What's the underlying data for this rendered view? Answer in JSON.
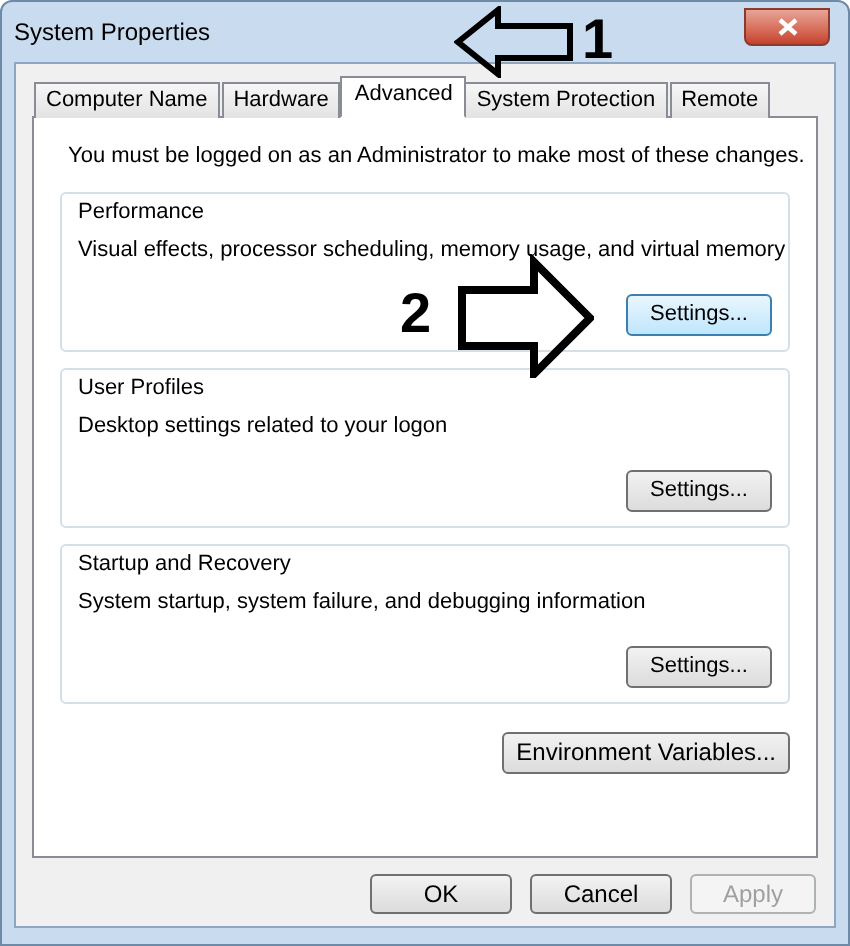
{
  "window": {
    "title": "System Properties"
  },
  "tabs": [
    {
      "label": "Computer Name",
      "selected": false
    },
    {
      "label": "Hardware",
      "selected": false
    },
    {
      "label": "Advanced",
      "selected": true
    },
    {
      "label": "System Protection",
      "selected": false
    },
    {
      "label": "Remote",
      "selected": false
    }
  ],
  "notice": "You must be logged on as an Administrator to make most of these changes.",
  "groups": [
    {
      "title": "Performance",
      "description": "Visual effects, processor scheduling, memory usage, and virtual memory",
      "button": "Settings...",
      "focused": true
    },
    {
      "title": "User Profiles",
      "description": "Desktop settings related to your logon",
      "button": "Settings...",
      "focused": false
    },
    {
      "title": "Startup and Recovery",
      "description": "System startup, system failure, and debugging information",
      "button": "Settings...",
      "focused": false
    }
  ],
  "environment_button": "Environment Variables...",
  "footer_buttons": [
    {
      "label": "OK",
      "disabled": false
    },
    {
      "label": "Cancel",
      "disabled": false
    },
    {
      "label": "Apply",
      "disabled": true
    }
  ],
  "annotations": [
    {
      "label": "1",
      "kind": "left"
    },
    {
      "label": "2",
      "kind": "right"
    }
  ]
}
